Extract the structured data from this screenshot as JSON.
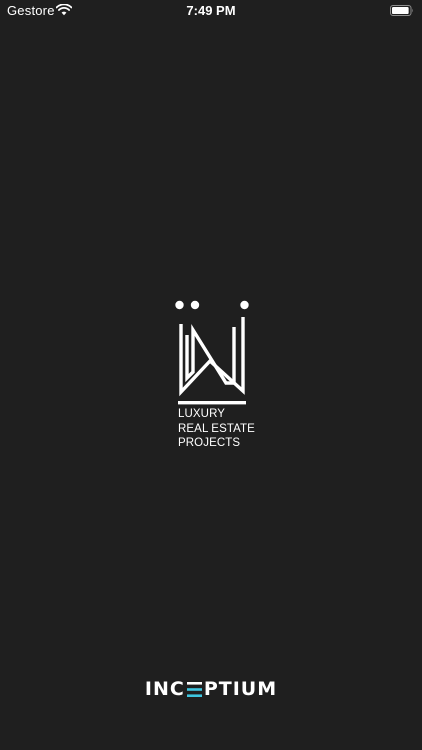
{
  "status_bar": {
    "carrier": "Gestore",
    "time": "7:49 PM",
    "battery_level": 0.95
  },
  "splash": {
    "tagline": [
      "LUXURY",
      "REAL ESTATE",
      "PROJECTS"
    ]
  },
  "footer": {
    "brand_left": "INC",
    "brand_right": "PTIUM",
    "accent_color": "#3ec6e0"
  },
  "colors": {
    "background": "#1f1f1f",
    "foreground": "#ffffff"
  }
}
